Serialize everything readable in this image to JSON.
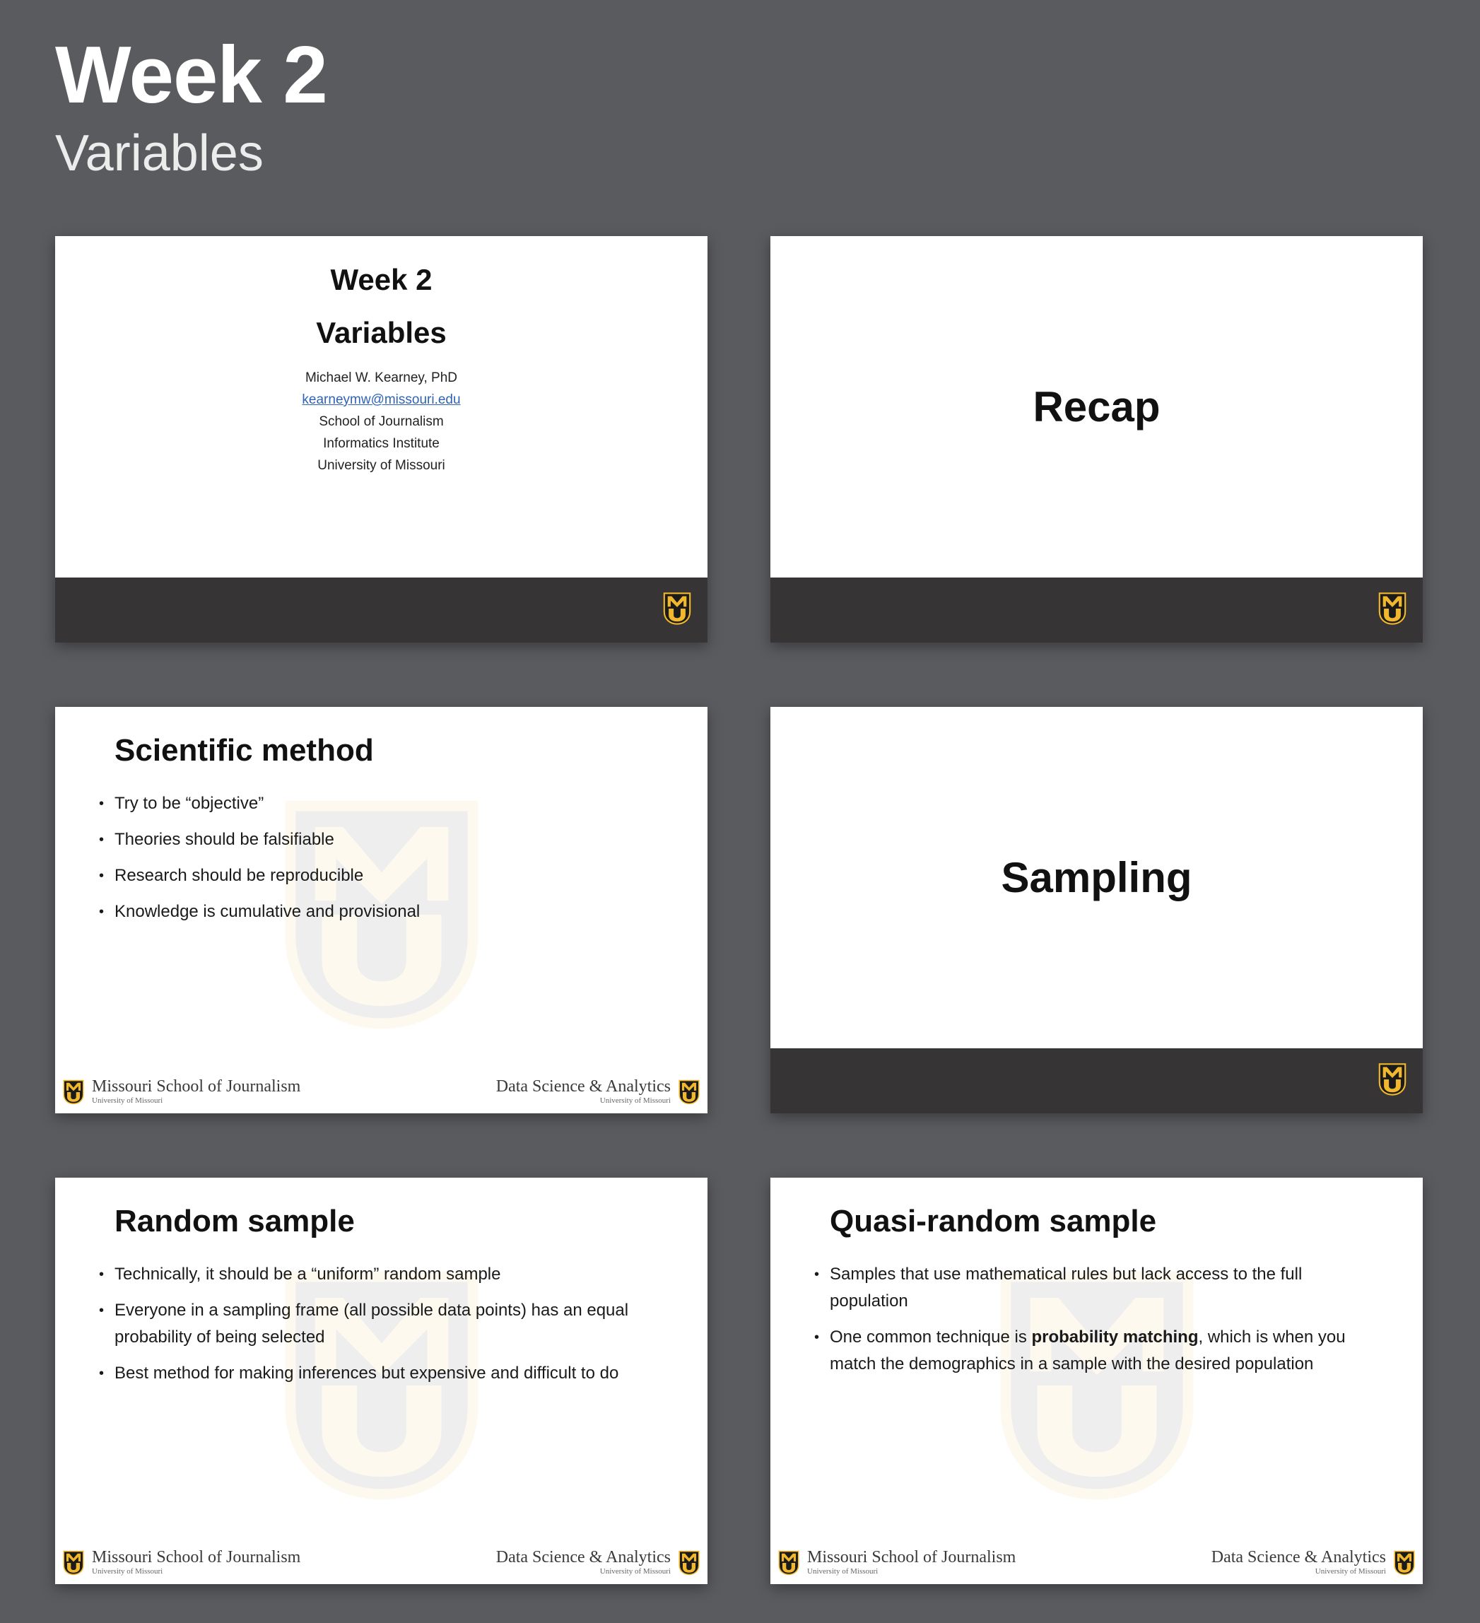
{
  "page": {
    "title": "Week 2",
    "subtitle": "Variables"
  },
  "footer": {
    "left_main": "Missouri School of Journalism",
    "left_sub": "University of Missouri",
    "right_main": "Data Science & Analytics",
    "right_sub": "University of Missouri"
  },
  "slides": {
    "title_slide": {
      "week": "Week 2",
      "topic": "Variables",
      "author": "Michael W. Kearney, PhD",
      "email": "kearneymw@missouri.edu",
      "affiliation_1": "School of Journalism",
      "affiliation_2": "Informatics Institute",
      "affiliation_3": "University of Missouri"
    },
    "recap": {
      "title": "Recap"
    },
    "scientific_method": {
      "title": "Scientific method",
      "bullets": [
        "Try to be “objective”",
        "Theories should be falsifiable",
        "Research should be reproducible",
        "Knowledge is cumulative and provisional"
      ]
    },
    "sampling": {
      "title": "Sampling"
    },
    "random_sample": {
      "title": "Random sample",
      "bullets": [
        "Technically, it should be a “uniform” random sample",
        "Everyone in a sampling frame (all possible data points) has an equal probability of being selected",
        "Best method for making inferences but expensive and difficult to do"
      ]
    },
    "quasi_random": {
      "title": "Quasi-random sample",
      "bullet_1": "Samples that use mathematical rules but lack access to the full population",
      "bullet_2_before": "One common technique is ",
      "bullet_2_bold": "probability matching",
      "bullet_2_after": ", which is when you match the demographics in a sample with the desired population"
    }
  },
  "colors": {
    "background": "#5a5b5f",
    "dark_bar": "#363435",
    "mizzou_gold": "#f1b82d",
    "link": "#2f64b5"
  }
}
